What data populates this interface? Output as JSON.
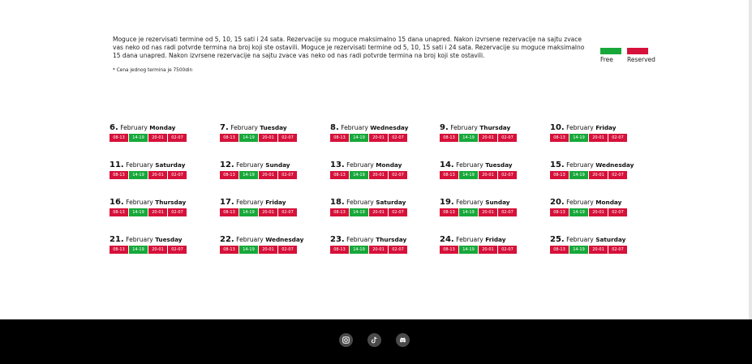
{
  "info": {
    "text": "Moguce je rezervisati termine od 5, 10, 15 sati i 24 sata. Rezervacije su moguce maksimalno 15 dana unapred. Nakon izvrsene rezervacije na sajtu zvace vas neko od nas radi potvrde termina na broj koji ste ostavili. Moguce je rezervisati termine od 5, 10, 15 sati i 24 sata. Rezervacije su moguce maksimalno 15 dana unapred. Nakon izvrsene rezervacije na sajtu zvace vas neko od nas radi potvrde termina na broj koji ste ostavili.",
    "note": "* Cena jednog termina je 7500din"
  },
  "legend": {
    "free_label": "Free",
    "reserved_label": "Reserved",
    "free_color": "#17a83a",
    "reserved_color": "#d6113a"
  },
  "slot_labels": [
    "08-13",
    "14-19",
    "20-01",
    "02-07"
  ],
  "days": [
    {
      "num": "6.",
      "month": "February",
      "weekday": "Monday",
      "slots": [
        "reserved",
        "free",
        "reserved",
        "reserved"
      ]
    },
    {
      "num": "7.",
      "month": "February",
      "weekday": "Tuesday",
      "slots": [
        "reserved",
        "free",
        "reserved",
        "reserved"
      ]
    },
    {
      "num": "8.",
      "month": "February",
      "weekday": "Wednesday",
      "slots": [
        "reserved",
        "free",
        "reserved",
        "reserved"
      ]
    },
    {
      "num": "9.",
      "month": "February",
      "weekday": "Thursday",
      "slots": [
        "reserved",
        "free",
        "reserved",
        "reserved"
      ]
    },
    {
      "num": "10.",
      "month": "February",
      "weekday": "Friday",
      "slots": [
        "reserved",
        "free",
        "reserved",
        "reserved"
      ]
    },
    {
      "num": "11.",
      "month": "February",
      "weekday": "Saturday",
      "slots": [
        "reserved",
        "free",
        "reserved",
        "reserved"
      ]
    },
    {
      "num": "12.",
      "month": "February",
      "weekday": "Sunday",
      "slots": [
        "reserved",
        "free",
        "reserved",
        "reserved"
      ]
    },
    {
      "num": "13.",
      "month": "February",
      "weekday": "Monday",
      "slots": [
        "reserved",
        "free",
        "reserved",
        "reserved"
      ]
    },
    {
      "num": "14.",
      "month": "February",
      "weekday": "Tuesday",
      "slots": [
        "reserved",
        "free",
        "reserved",
        "reserved"
      ]
    },
    {
      "num": "15.",
      "month": "February",
      "weekday": "Wednesday",
      "slots": [
        "reserved",
        "free",
        "reserved",
        "reserved"
      ]
    },
    {
      "num": "16.",
      "month": "February",
      "weekday": "Thursday",
      "slots": [
        "reserved",
        "free",
        "reserved",
        "reserved"
      ]
    },
    {
      "num": "17.",
      "month": "February",
      "weekday": "Friday",
      "slots": [
        "reserved",
        "free",
        "reserved",
        "reserved"
      ]
    },
    {
      "num": "18.",
      "month": "February",
      "weekday": "Saturday",
      "slots": [
        "reserved",
        "free",
        "reserved",
        "reserved"
      ]
    },
    {
      "num": "19.",
      "month": "February",
      "weekday": "Sunday",
      "slots": [
        "reserved",
        "free",
        "reserved",
        "reserved"
      ]
    },
    {
      "num": "20.",
      "month": "February",
      "weekday": "Monday",
      "slots": [
        "reserved",
        "free",
        "reserved",
        "reserved"
      ]
    },
    {
      "num": "21.",
      "month": "February",
      "weekday": "Tuesday",
      "slots": [
        "reserved",
        "free",
        "reserved",
        "reserved"
      ]
    },
    {
      "num": "22.",
      "month": "February",
      "weekday": "Wednesday",
      "slots": [
        "reserved",
        "free",
        "reserved",
        "reserved"
      ]
    },
    {
      "num": "23.",
      "month": "February",
      "weekday": "Thursday",
      "slots": [
        "reserved",
        "free",
        "reserved",
        "reserved"
      ]
    },
    {
      "num": "24.",
      "month": "February",
      "weekday": "Friday",
      "slots": [
        "reserved",
        "free",
        "reserved",
        "reserved"
      ]
    },
    {
      "num": "25.",
      "month": "February",
      "weekday": "Saturday",
      "slots": [
        "reserved",
        "free",
        "reserved",
        "reserved"
      ]
    }
  ],
  "footer": {
    "icons": [
      "instagram-icon",
      "tiktok-icon",
      "discord-icon"
    ]
  }
}
